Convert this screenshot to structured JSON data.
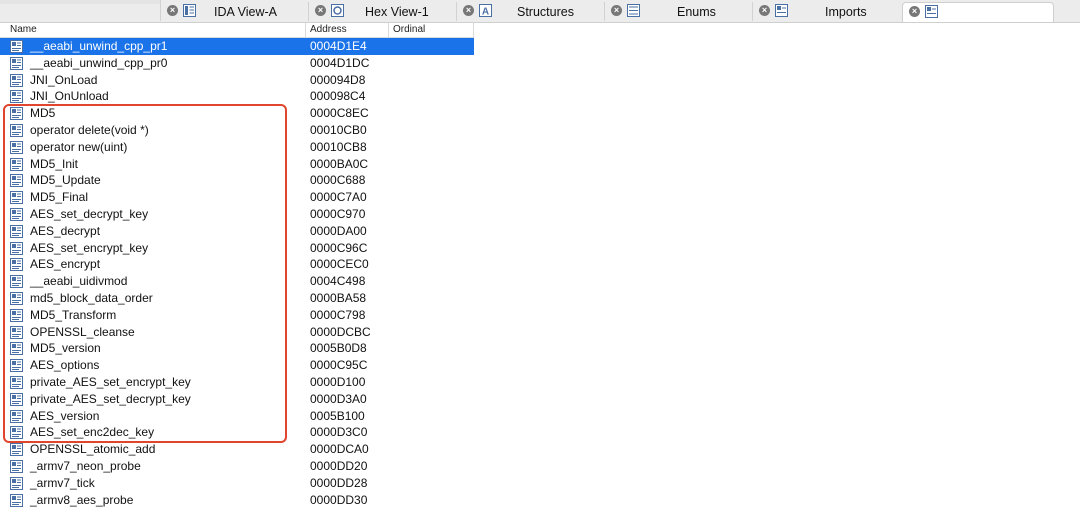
{
  "tabs": [
    {
      "label": "IDA View-A"
    },
    {
      "label": "Hex View-1"
    },
    {
      "label": "Structures"
    },
    {
      "label": "Enums"
    },
    {
      "label": "Imports"
    },
    {
      "label": ""
    }
  ],
  "table": {
    "columns": [
      "Name",
      "Address",
      "Ordinal"
    ],
    "rows": [
      {
        "name": "__aeabi_unwind_cpp_pr1",
        "address": "0004D1E4"
      },
      {
        "name": "__aeabi_unwind_cpp_pr0",
        "address": "0004D1DC"
      },
      {
        "name": "JNI_OnLoad",
        "address": "000094D8"
      },
      {
        "name": "JNI_OnUnload",
        "address": "000098C4"
      },
      {
        "name": "MD5",
        "address": "0000C8EC"
      },
      {
        "name": "operator delete(void *)",
        "address": "00010CB0"
      },
      {
        "name": "operator new(uint)",
        "address": "00010CB8"
      },
      {
        "name": "MD5_Init",
        "address": "0000BA0C"
      },
      {
        "name": "MD5_Update",
        "address": "0000C688"
      },
      {
        "name": "MD5_Final",
        "address": "0000C7A0"
      },
      {
        "name": "AES_set_decrypt_key",
        "address": "0000C970"
      },
      {
        "name": "AES_decrypt",
        "address": "0000DA00"
      },
      {
        "name": "AES_set_encrypt_key",
        "address": "0000C96C"
      },
      {
        "name": "AES_encrypt",
        "address": "0000CEC0"
      },
      {
        "name": "__aeabi_uidivmod",
        "address": "0004C498"
      },
      {
        "name": "md5_block_data_order",
        "address": "0000BA58"
      },
      {
        "name": "MD5_Transform",
        "address": "0000C798"
      },
      {
        "name": "OPENSSL_cleanse",
        "address": "0000DCBC"
      },
      {
        "name": "MD5_version",
        "address": "0005B0D8"
      },
      {
        "name": "AES_options",
        "address": "0000C95C"
      },
      {
        "name": "private_AES_set_encrypt_key",
        "address": "0000D100"
      },
      {
        "name": "private_AES_set_decrypt_key",
        "address": "0000D3A0"
      },
      {
        "name": "AES_version",
        "address": "0005B100"
      },
      {
        "name": "AES_set_enc2dec_key",
        "address": "0000D3C0"
      },
      {
        "name": "OPENSSL_atomic_add",
        "address": "0000DCA0"
      },
      {
        "name": "_armv7_neon_probe",
        "address": "0000DD20"
      },
      {
        "name": "_armv7_tick",
        "address": "0000DD28"
      },
      {
        "name": "_armv8_aes_probe",
        "address": "0000DD30"
      }
    ],
    "selected_index": 0
  },
  "colors": {
    "selection": "#1a73e8",
    "highlight_box": "#e0452e"
  },
  "icons": {
    "tab_close": "close-icon",
    "row": "function-icon"
  }
}
